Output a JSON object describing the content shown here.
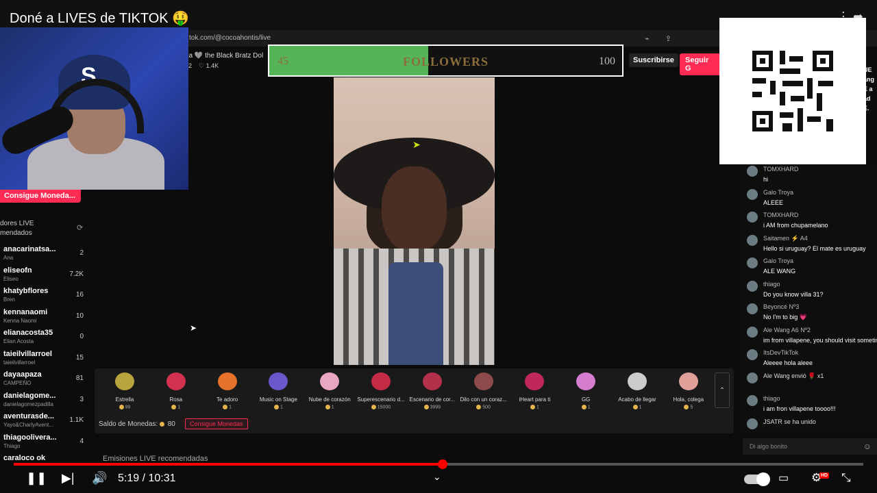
{
  "video": {
    "title": "Doné a LIVES de TIKTOK 🤑",
    "time_current": "5:19",
    "time_total": "10:31",
    "time_display": "5:19 / 10:31",
    "progress_fraction": 0.505
  },
  "browser": {
    "url": "tok.com/@cocoahontis/live"
  },
  "host": {
    "name_line": "oa 🩶 the Black Bratz Dol",
    "viewers": "72",
    "likes": "♡ 1.4K"
  },
  "actions": {
    "subscribe": "Suscribirse",
    "follow": "Seguir G"
  },
  "goal": {
    "current": "45",
    "label": "FOLLOWERS",
    "target": "100",
    "fill_fraction": 0.45
  },
  "sidebar": {
    "get_coins": "Consigue Moneda",
    "heading_line1": "dores LIVE",
    "heading_line2": "mendados",
    "items": [
      {
        "name": "anacarinatsa...",
        "sub": "Ana",
        "count": "2"
      },
      {
        "name": "eliseofn",
        "sub": "Eliseo",
        "count": "7.2K"
      },
      {
        "name": "khatybflores",
        "sub": "Bren",
        "count": "16"
      },
      {
        "name": "kennanaomi",
        "sub": "Kenna Naomi",
        "count": "10"
      },
      {
        "name": "elianacosta35",
        "sub": "Elian Acosta",
        "count": "0"
      },
      {
        "name": "taieilvillarroel",
        "sub": "taieilvillarroel",
        "count": "15"
      },
      {
        "name": "dayaapaza",
        "sub": "CAMPEÑO",
        "count": "81"
      },
      {
        "name": "danielagome...",
        "sub": "danielagomezpadilla",
        "count": "3"
      },
      {
        "name": "aventurasde...",
        "sub": "Yayo&CharlyAvent...",
        "count": "1.1K"
      },
      {
        "name": "thiagoolivera...",
        "sub": "Thiago",
        "count": "4"
      },
      {
        "name": "caraloco ok",
        "sub": "",
        "count": ""
      }
    ]
  },
  "gifts": [
    {
      "name": "Estrella",
      "price": "99",
      "color": "#b7a43c"
    },
    {
      "name": "Rosa",
      "price": "1",
      "color": "#d2314f"
    },
    {
      "name": "Te adoro",
      "price": "1",
      "color": "#e4722b"
    },
    {
      "name": "Music on Stage",
      "price": "1",
      "color": "#6a57c9"
    },
    {
      "name": "Nube de corazón",
      "price": "1",
      "color": "#e8a6c2"
    },
    {
      "name": "Superescenario d...",
      "price": "15000",
      "color": "#c42c45"
    },
    {
      "name": "Escenario de cor...",
      "price": "3999",
      "color": "#b2304a"
    },
    {
      "name": "Dilo con un coraz...",
      "price": "500",
      "color": "#8c4a4a"
    },
    {
      "name": "iHeart para ti",
      "price": "1",
      "color": "#c2275a"
    },
    {
      "name": "GG",
      "price": "1",
      "color": "#d57dcf"
    },
    {
      "name": "Acabo de llegar",
      "price": "1",
      "color": "#cccccc"
    },
    {
      "name": "Hola, colega",
      "price": "5",
      "color": "#e0a09a"
    }
  ],
  "gift_panel": {
    "balance_label": "Saldo de Monedas:",
    "balance_value": "80",
    "recharge": "Consigue Monedas",
    "arrow": "⌃"
  },
  "recommended_heading": "Emisiones LIVE recomendadas",
  "chat": {
    "messages": [
      {
        "user": "TOMXHARD",
        "text": "hi"
      },
      {
        "user": "Galo Troya",
        "text": "ALEEE"
      },
      {
        "user": "TOMXHARD",
        "text": "i AM from chupamelano"
      },
      {
        "user": "Saitamen ⚡ A4",
        "text": "Hello si uruguay? El mate es uruguay"
      },
      {
        "user": "Galo Troya",
        "text": "ALE WANG"
      },
      {
        "user": "thiago",
        "text": "Do you know villa 31?"
      },
      {
        "user": "Beyoncé Nº3",
        "text": "No I'm to big 💗"
      },
      {
        "user": "Ale Wang A6 Nº2",
        "text": "im from villapene, you should visit sometime its beatiful place"
      },
      {
        "user": "ItsDevTikTok",
        "text": "Aleeee hola aleee"
      },
      {
        "user": "",
        "text": "Ale Wang envió 🌹 x1"
      },
      {
        "user": "thiago",
        "text": "i am fron villapene toooo!!!"
      },
      {
        "user": "",
        "text": "JSATR se ha unido"
      }
    ],
    "input_placeholder": "Di algo bonito"
  },
  "edge_chat_fragments": [
    "UE",
    "ang",
    "E a",
    "ad",
    "E."
  ],
  "icons": {
    "play_pause": "pause-icon",
    "next": "next-icon",
    "volume": "volume-icon",
    "chevron": "chevron-down-icon",
    "autoplay": "autoplay-toggle",
    "captions": "captions-icon",
    "settings": "settings-icon",
    "fullscreen": "exit-fullscreen-icon"
  },
  "colors": {
    "tiktok_red": "#fe2c55",
    "goal_green": "#55b556",
    "youtube_red": "#ff0000"
  }
}
